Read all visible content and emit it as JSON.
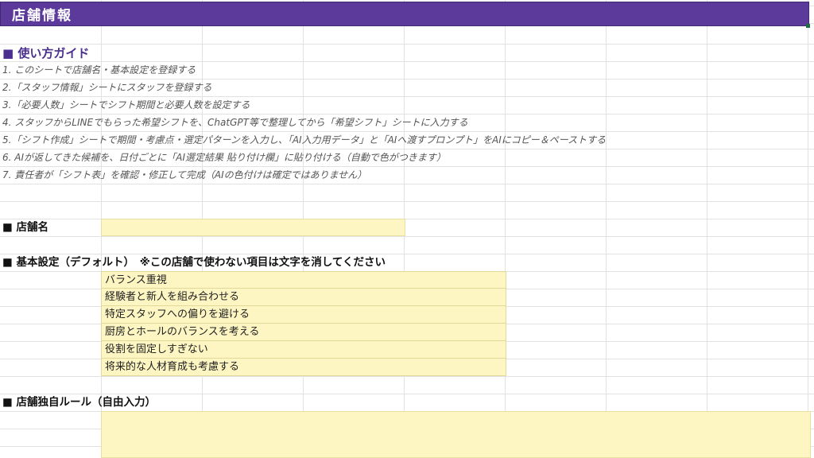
{
  "sheet": {
    "title": "店舗情報"
  },
  "guide": {
    "heading": "■ 使い方ガイド",
    "steps": [
      "1. このシートで店舗名・基本設定を登録する",
      "2.「スタッフ情報」シートにスタッフを登録する",
      "3.「必要人数」シートでシフト期間と必要人数を設定する",
      "4. スタッフからLINEでもらった希望シフトを、ChatGPT等で整理してから「希望シフト」シートに入力する",
      "5.「シフト作成」シートで期間・考慮点・選定パターンを入力し、「AI入力用データ」と「AIへ渡すプロンプト」をAIにコピー＆ペーストする",
      "6. AIが返してきた候補を、日付ごとに「AI選定結果 貼り付け欄」に貼り付ける（自動で色がつきます）",
      "7. 責任者が「シフト表」を確認・修正して完成（AIの色付けは確定ではありません）"
    ]
  },
  "store_name": {
    "label": "■ 店舗名",
    "value": ""
  },
  "basic_settings": {
    "label": "■ 基本設定（デフォルト）　※この店舗で使わない項目は文字を消してください",
    "options": [
      "バランス重視",
      "経験者と新人を組み合わせる",
      "特定スタッフへの偏りを避ける",
      "厨房とホールのバランスを考える",
      "役割を固定しすぎない",
      "将来的な人材育成も考慮する"
    ]
  },
  "custom_rules": {
    "label": "■ 店舗独自ルール（自由入力）",
    "value": ""
  },
  "colors": {
    "title_bg": "#5b3a9c",
    "input_cell": "#fdf5c2",
    "guide_heading": "#4a2f8f"
  }
}
